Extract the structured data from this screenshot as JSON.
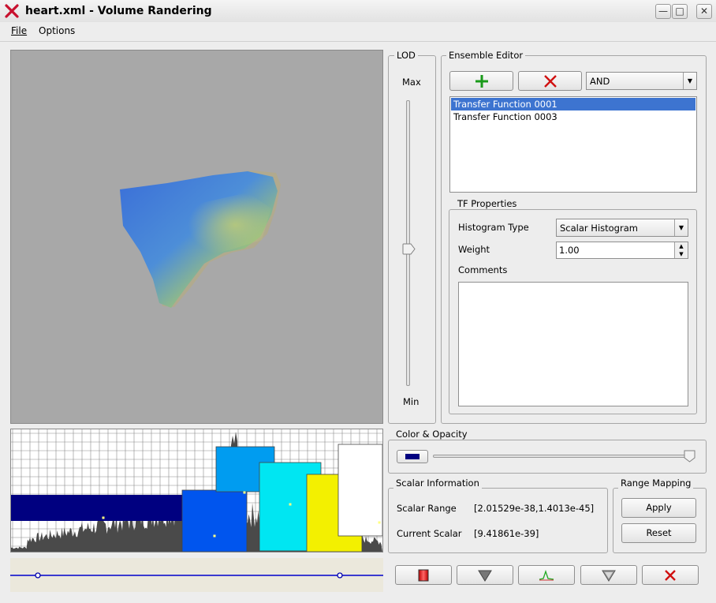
{
  "window": {
    "title": "heart.xml - Volume Randering"
  },
  "menu": {
    "file": "File",
    "options": "Options"
  },
  "lod": {
    "title": "LOD",
    "max": "Max",
    "min": "Min",
    "value": 0.5
  },
  "ensemble": {
    "title": "Ensemble Editor",
    "operator": "AND",
    "items": [
      "Transfer Function 0001",
      "Transfer Function 0003"
    ],
    "selected_index": 0
  },
  "tf": {
    "title": "TF Properties",
    "histogram_label": "Histogram Type",
    "histogram_value": "Scalar Histogram",
    "weight_label": "Weight",
    "weight_value": "1.00",
    "comments_label": "Comments",
    "comments_value": ""
  },
  "color_opacity": {
    "title": "Color & Opacity",
    "swatch_color": "#000080",
    "opacity": 0.97
  },
  "scalar_info": {
    "title": "Scalar Information",
    "range_label": "Scalar Range",
    "range_value": "[2.01529e-38,1.4013e-45]",
    "current_label": "Current Scalar",
    "current_value": "[9.41861e-39]"
  },
  "range_mapping": {
    "title": "Range Mapping",
    "apply": "Apply",
    "reset": "Reset"
  },
  "colors": {
    "accent_selection": "#3d74d0",
    "axis_line": "#0000cc"
  }
}
